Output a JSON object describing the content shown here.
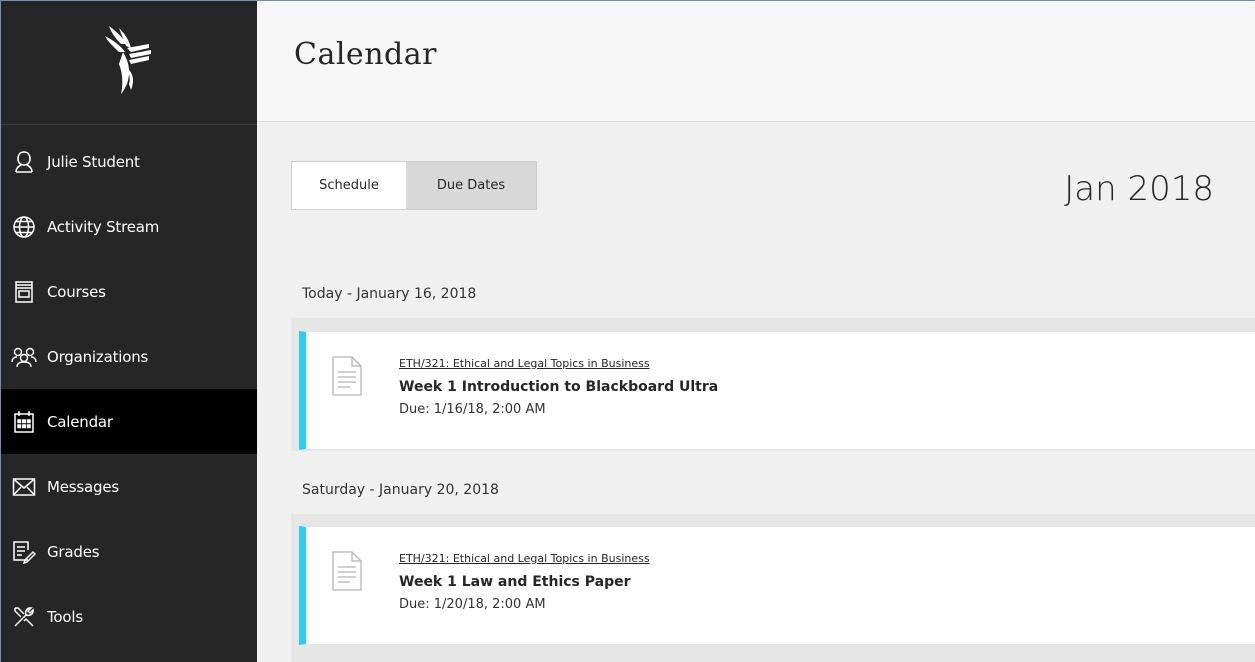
{
  "sidebar": {
    "items": [
      {
        "label": "Julie Student",
        "icon": "user-icon"
      },
      {
        "label": "Activity Stream",
        "icon": "globe-icon"
      },
      {
        "label": "Courses",
        "icon": "courses-icon"
      },
      {
        "label": "Organizations",
        "icon": "organizations-icon"
      },
      {
        "label": "Calendar",
        "icon": "calendar-icon",
        "active": true
      },
      {
        "label": "Messages",
        "icon": "envelope-icon"
      },
      {
        "label": "Grades",
        "icon": "grades-icon"
      },
      {
        "label": "Tools",
        "icon": "tools-icon"
      }
    ]
  },
  "header": {
    "title": "Calendar"
  },
  "tabs": {
    "schedule": "Schedule",
    "due_dates": "Due Dates",
    "selected": "Due Dates"
  },
  "month": "Jan 2018",
  "days": [
    {
      "header": "Today - January 16, 2018",
      "event": {
        "course": "ETH/321: Ethical and Legal Topics in Business",
        "title": "Week 1 Introduction to Blackboard Ultra",
        "due": "Due: 1/16/18, 2:00 AM"
      }
    },
    {
      "header": "Saturday - January 20, 2018",
      "event": {
        "course": "ETH/321: Ethical and Legal Topics in Business",
        "title": "Week 1 Law and Ethics Paper",
        "due": "Due: 1/20/18, 2:00 AM"
      }
    }
  ],
  "colors": {
    "accent": "#2bcdf0",
    "sidebar_bg": "#262626",
    "active_bg": "#000000"
  }
}
